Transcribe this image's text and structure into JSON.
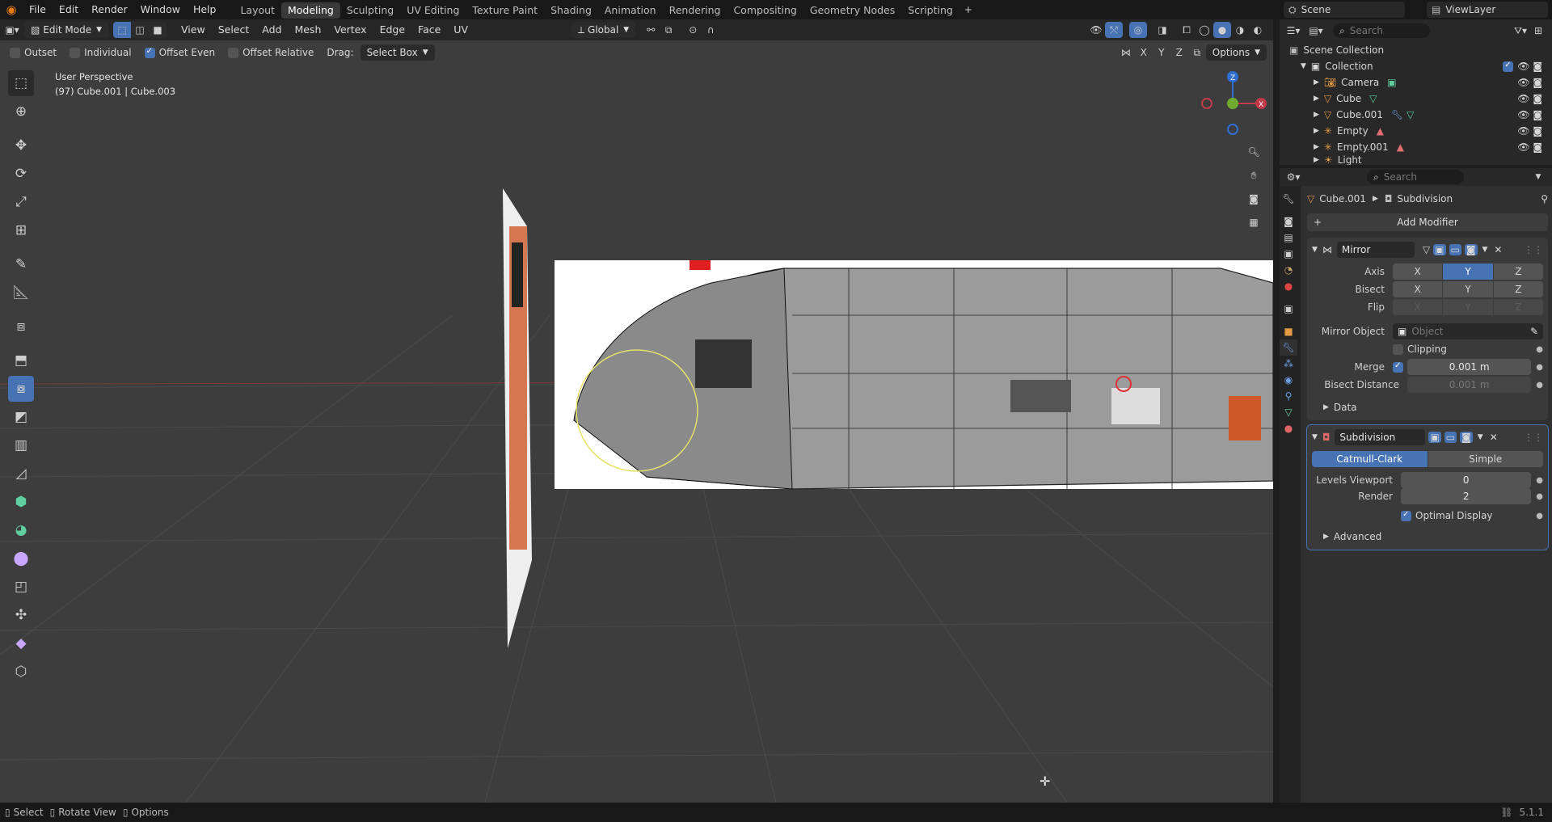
{
  "menus": [
    "File",
    "Edit",
    "Render",
    "Window",
    "Help"
  ],
  "workspaces": [
    "Layout",
    "Modeling",
    "Sculpting",
    "UV Editing",
    "Texture Paint",
    "Shading",
    "Animation",
    "Rendering",
    "Compositing",
    "Geometry Nodes",
    "Scripting"
  ],
  "active_workspace": "Modeling",
  "scene": {
    "label": "Scene",
    "viewlayer": "ViewLayer"
  },
  "viewport_header": {
    "mode": "Edit Mode",
    "menus": [
      "View",
      "Select",
      "Add",
      "Mesh",
      "Vertex",
      "Edge",
      "Face",
      "UV"
    ],
    "orientation": "Global",
    "axes": [
      "X",
      "Y",
      "Z"
    ],
    "options": "Options"
  },
  "tool_header": {
    "outset": "Outset",
    "individual": "Individual",
    "offset_even": "Offset Even",
    "offset_relative": "Offset Relative",
    "drag_label": "Drag:",
    "drag_value": "Select Box"
  },
  "viewport_info": {
    "line1": "User Perspective",
    "line2": "(97) Cube.001 | Cube.003"
  },
  "outliner": {
    "search_placeholder": "Search",
    "scene_collection": "Scene Collection",
    "collection": "Collection",
    "items": [
      "Camera",
      "Cube",
      "Cube.001",
      "Empty",
      "Empty.001",
      "Light"
    ]
  },
  "properties": {
    "search_placeholder": "Search",
    "breadcrumb_object": "Cube.001",
    "breadcrumb_modifier": "Subdivision",
    "add_modifier": "Add Modifier",
    "mirror": {
      "name": "Mirror",
      "axis_label": "Axis",
      "bisect_label": "Bisect",
      "flip_label": "Flip",
      "axes": [
        "X",
        "Y",
        "Z"
      ],
      "mirror_object_label": "Mirror Object",
      "mirror_object_placeholder": "Object",
      "clipping": "Clipping",
      "merge_label": "Merge",
      "merge_value": "0.001 m",
      "bisect_distance_label": "Bisect Distance",
      "bisect_distance_value": "0.001 m",
      "data": "Data"
    },
    "subdivision": {
      "name": "Subdivision",
      "catmull": "Catmull-Clark",
      "simple": "Simple",
      "levels_label": "Levels Viewport",
      "levels_value": "0",
      "render_label": "Render",
      "render_value": "2",
      "optimal": "Optimal Display",
      "advanced": "Advanced"
    }
  },
  "statusbar": {
    "select": "Select",
    "rotate": "Rotate View",
    "options": "Options",
    "version": "5.1.1"
  },
  "colors": {
    "accent": "#4772b3",
    "viewport": "#3d3d3d",
    "panel": "#303030"
  }
}
